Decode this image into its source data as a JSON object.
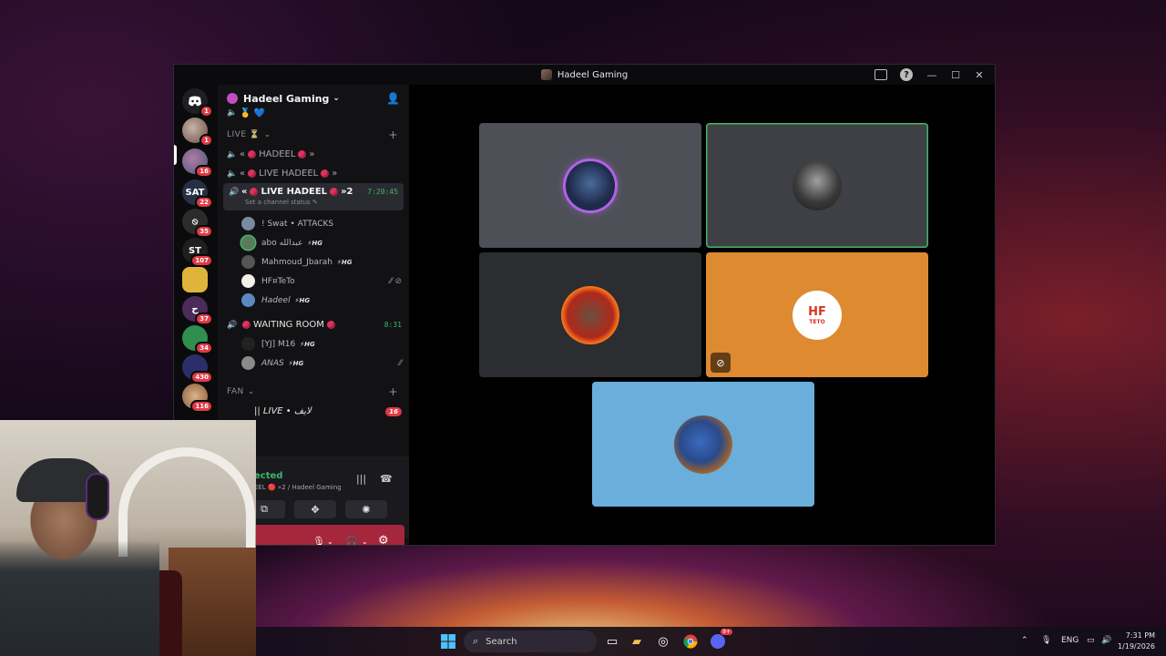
{
  "window": {
    "title": "Hadeel Gaming"
  },
  "rail": {
    "badges": [
      "1",
      "1",
      "16",
      "22",
      "35",
      "107",
      "37",
      "34",
      "430",
      "116"
    ]
  },
  "sidebar": {
    "server_name": "Hadeel Gaming",
    "top_channel_emoji": "🥇 💙",
    "categories": {
      "live": "LIVE ⏳",
      "fan": "FAN"
    },
    "channels": [
      {
        "prefix": "«",
        "name": "HADEEL",
        "suffix": "»"
      },
      {
        "prefix": "«",
        "name": "LIVE HADEEL",
        "suffix": "»"
      }
    ],
    "active_channel": {
      "prefix": "«",
      "name": "LIVE HADEEL",
      "suffix": "»2",
      "timer": "7:20:45",
      "status": "Set a channel status ✎"
    },
    "members": [
      {
        "name": "! Swat • ATTACKS",
        "tag": ""
      },
      {
        "name": "abo عبدالله",
        "tag": "⚡HG"
      },
      {
        "name": "Mahmoud_Jbarah",
        "tag": "⚡HG"
      },
      {
        "name": "HF¤TeTo",
        "tag": ""
      },
      {
        "name": "Hadeel",
        "tag": "⚡HG"
      }
    ],
    "waiting_room": {
      "name": "WAITING ROOM",
      "timer": "8:31"
    },
    "waiting_members": [
      {
        "name": "[YJ] M16",
        "tag": "⚡HG"
      },
      {
        "name": "ANAS",
        "tag": "⚡HG"
      }
    ],
    "fan_channel": {
      "name": "|| LIVE • لايف",
      "count": "16"
    }
  },
  "voice_panel": {
    "connected": "ected",
    "sub": "EEL 🔴 »2 / Hadeel Gaming"
  },
  "taskbar": {
    "search_label": "Search",
    "lang": "ENG",
    "time": "7:31 PM",
    "date": "1/19/2026",
    "discord_badge": "9+"
  },
  "colors": {
    "tile_gray_1": "#4e5058",
    "tile_gray_2": "#3f4045",
    "tile_gray_3": "#2b2d31",
    "tile_orange": "#dd8a31",
    "tile_blue": "#6aaedc",
    "speaking_border": "#3fb66a",
    "accent_red": "#e03a45"
  }
}
